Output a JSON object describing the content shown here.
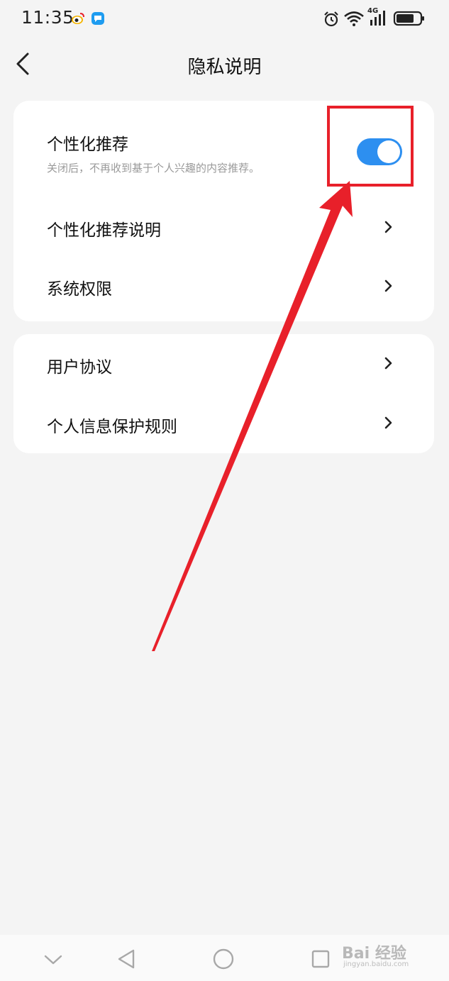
{
  "status_bar": {
    "time": "11:35",
    "network": "4G"
  },
  "header": {
    "title": "隐私说明"
  },
  "card1": {
    "toggle_row": {
      "title": "个性化推荐",
      "description": "关闭后，不再收到基于个人兴趣的内容推荐。",
      "enabled": true
    },
    "rows": [
      {
        "label": "个性化推荐说明"
      },
      {
        "label": "系统权限"
      }
    ]
  },
  "card2": {
    "rows": [
      {
        "label": "用户协议"
      },
      {
        "label": "个人信息保护规则"
      }
    ]
  },
  "watermark": {
    "logo": "Bai 经验",
    "url": "jingyan.baidu.com"
  },
  "colors": {
    "accent": "#2d8ff0",
    "annotation": "#e8202a",
    "background": "#f4f4f4"
  }
}
